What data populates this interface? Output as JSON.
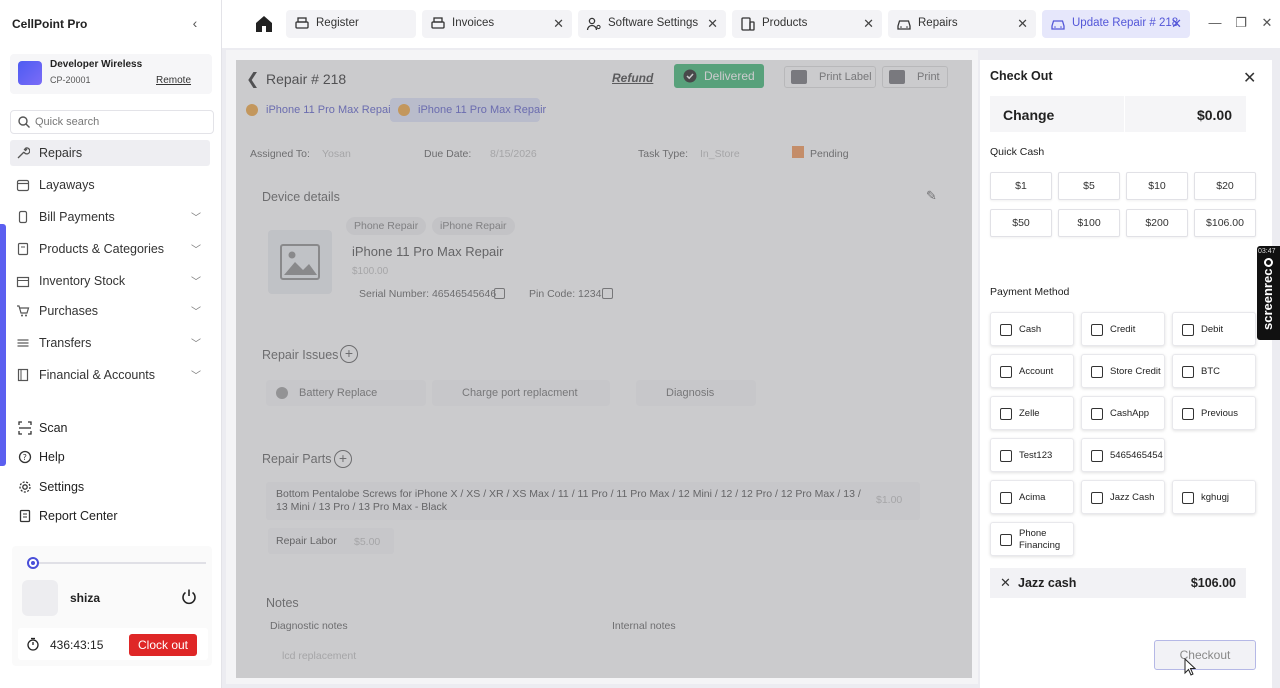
{
  "app": {
    "title": "CellPoint Pro"
  },
  "store": {
    "name": "Developer Wireless",
    "code": "CP-20001",
    "remote": "Remote"
  },
  "search": {
    "placeholder": "Quick search"
  },
  "nav": {
    "items": [
      {
        "label": "Repairs"
      },
      {
        "label": "Layaways"
      },
      {
        "label": "Bill Payments"
      },
      {
        "label": "Products & Categories"
      },
      {
        "label": "Inventory Stock"
      },
      {
        "label": "Purchases"
      },
      {
        "label": "Transfers"
      },
      {
        "label": "Financial & Accounts"
      }
    ],
    "secondary": [
      {
        "label": "Scan"
      },
      {
        "label": "Help"
      },
      {
        "label": "Settings"
      },
      {
        "label": "Report Center"
      }
    ]
  },
  "user": {
    "name": "shiza",
    "timer": "436:43:15",
    "clock_out": "Clock out"
  },
  "tabs": [
    {
      "label": "Register"
    },
    {
      "label": "Invoices"
    },
    {
      "label": "Software Settings"
    },
    {
      "label": "Products"
    },
    {
      "label": "Repairs"
    },
    {
      "label": "Update Repair # 218"
    }
  ],
  "repair": {
    "title_prefix": "Repair #",
    "number": "218",
    "refund": "Refund",
    "status": "Delivered",
    "print_label": "Print Label",
    "print": "Print",
    "tabs": [
      "iPhone 11 Pro Max Repair",
      "iPhone 11 Pro Max Repair"
    ],
    "assigned_to_label": "Assigned To:",
    "assigned_to_value": "Yosan",
    "due_date_label": "Due Date:",
    "due_date_value": "8/15/2026",
    "task_type_label": "Task Type:",
    "task_type_value": "In_Store",
    "status_value": "Pending",
    "device_details": "Device details",
    "chips": [
      "Phone Repair",
      "iPhone Repair"
    ],
    "device_name": "iPhone 11 Pro Max Repair",
    "device_price": "$100.00",
    "serial_label": "Serial Number:",
    "serial_value": "46546545646",
    "pin_label": "Pin Code:",
    "pin_value": "1234",
    "repair_issues": "Repair Issues",
    "issues": [
      "Battery Replace",
      "Charge port replacment",
      "Diagnosis"
    ],
    "repair_parts": "Repair Parts",
    "part_text": "Bottom Pentalobe Screws for iPhone X / XS / XR / XS Max / 11 / 11 Pro / 11 Pro Max / 12 Mini / 12 / 12 Pro / 12 Pro Max / 13 / 13 Mini / 13 Pro / 13 Pro Max - Black",
    "part_price": "$1.00",
    "labor": "Repair Labor",
    "labor_price": "$5.00",
    "notes": "Notes",
    "diagnostic_notes": "Diagnostic notes",
    "internal_notes": "Internal notes",
    "diagnostic_value": "lcd replacement"
  },
  "checkout": {
    "title": "Check Out",
    "change_label": "Change",
    "change_value": "$0.00",
    "quick_cash_label": "Quick Cash",
    "quick_cash": [
      "$1",
      "$5",
      "$10",
      "$20",
      "$50",
      "$100",
      "$200",
      "$106.00"
    ],
    "payment_method_label": "Payment Method",
    "methods": [
      "Cash",
      "Credit",
      "Debit",
      "Account",
      "Store Credit",
      "BTC",
      "Zelle",
      "CashApp",
      "Previous",
      "Test123",
      "5465465454",
      "Acima",
      "Jazz Cash",
      "kghugj",
      "Phone Financing"
    ],
    "selected_method": "Jazz cash",
    "selected_amount": "$106.00",
    "checkout_button": "Checkout"
  },
  "overlay_badge": {
    "time": "03:47",
    "label": "screenrec"
  }
}
